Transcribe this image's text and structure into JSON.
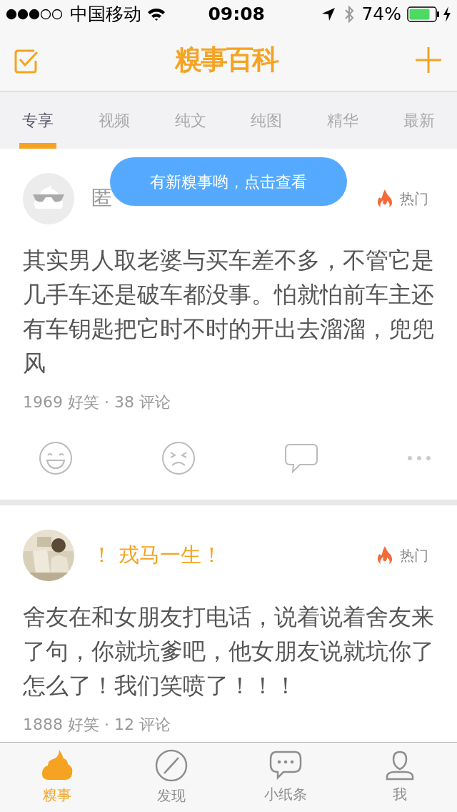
{
  "status_bar": {
    "carrier": "中国移动",
    "time": "09:08",
    "battery": "74%"
  },
  "header": {
    "logo": "糗事百科"
  },
  "tabs": [
    {
      "label": "专享",
      "selected": true
    },
    {
      "label": "视频",
      "selected": false
    },
    {
      "label": "纯文",
      "selected": false
    },
    {
      "label": "纯图",
      "selected": false
    },
    {
      "label": "精华",
      "selected": false
    },
    {
      "label": "最新",
      "selected": false
    }
  ],
  "toast": "有新糗事哟，点击查看",
  "posts": [
    {
      "avatar": {
        "kind": "anonymous"
      },
      "author": "匿",
      "author_highlight": false,
      "badge": "热门",
      "text": "其实男人取老婆与买车差不多，不管它是几手车还是破车都没事。怕就怕前车主还有车钥匙把它时不时的开出去溜溜，兜兜风",
      "stats": "1969 好笑 · 38 评论",
      "actions": true
    },
    {
      "author": "！ 戎马一生！",
      "author_highlight": true,
      "badge": "热门",
      "text": "舍友在和女朋友打电话，说着说着舍友来了句，你就坑爹吧，他女朋友说就坑你了怎么了！我们笑喷了！！！",
      "stats": "1888 好笑 · 12 评论",
      "actions": false
    }
  ],
  "bottom_tabs": [
    {
      "label": "糗事",
      "kind": "home",
      "selected": true
    },
    {
      "label": "发现",
      "kind": "discover",
      "selected": false
    },
    {
      "label": "小纸条",
      "kind": "messages",
      "selected": false
    },
    {
      "label": "我",
      "kind": "profile",
      "selected": false
    }
  ]
}
